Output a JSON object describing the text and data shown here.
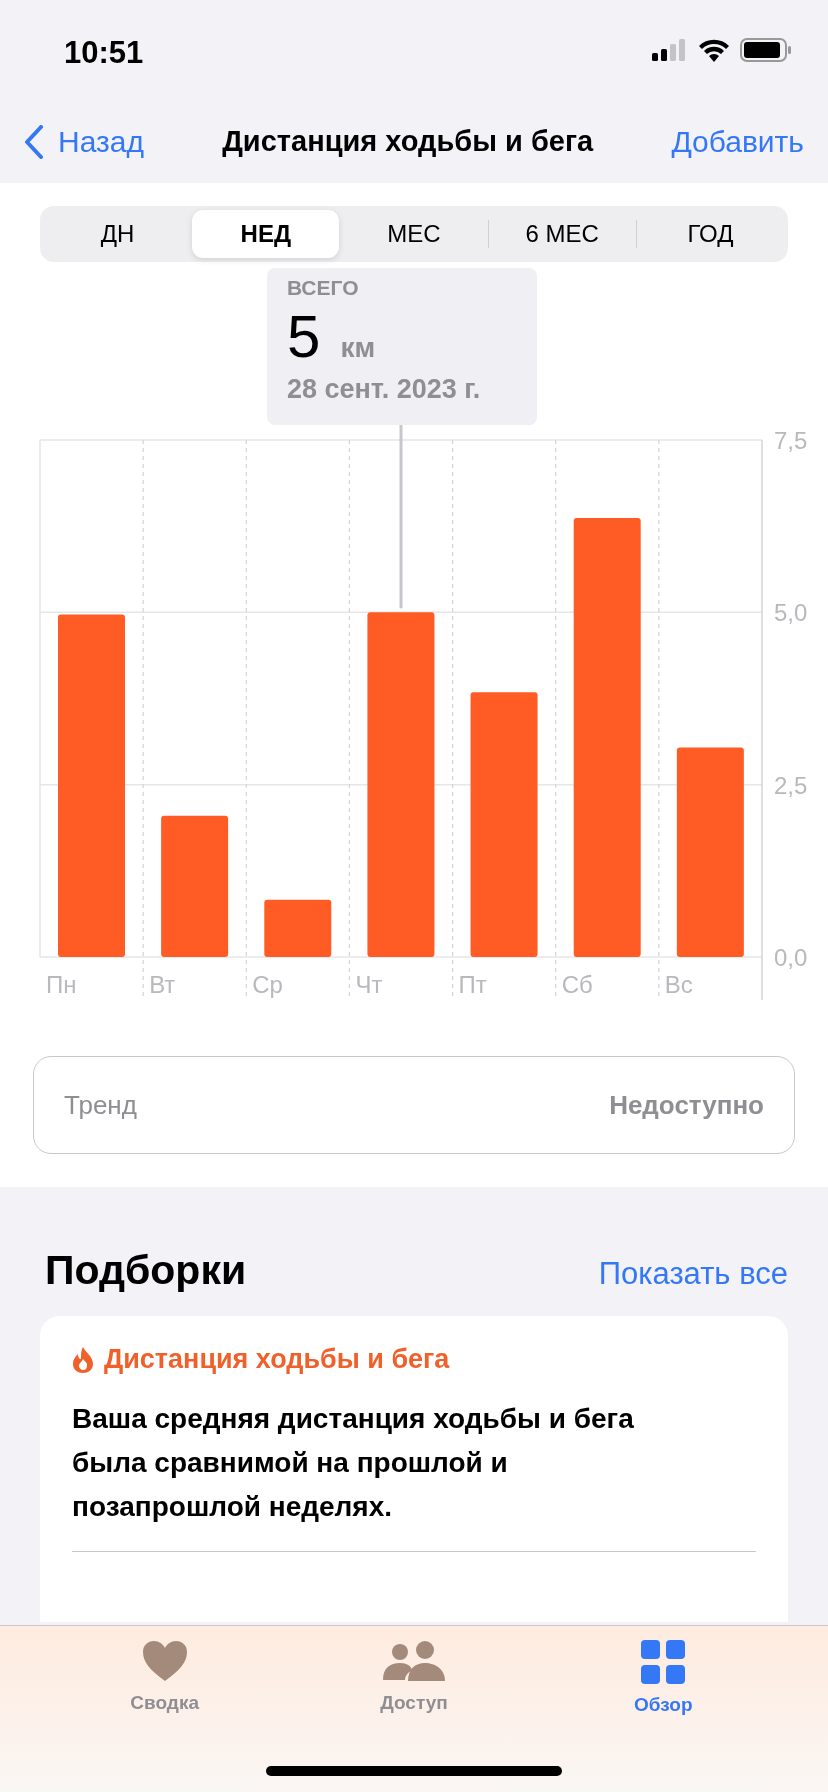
{
  "status_bar": {
    "time": "10:51"
  },
  "nav": {
    "back": "Назад",
    "title": "Дистанция ходьбы и бега",
    "action": "Добавить"
  },
  "ranges": [
    {
      "label": "ДН",
      "selected": false
    },
    {
      "label": "НЕД",
      "selected": true
    },
    {
      "label": "МЕС",
      "selected": false
    },
    {
      "label": "6 МЕС",
      "selected": false
    },
    {
      "label": "ГОД",
      "selected": false
    }
  ],
  "tooltip": {
    "heading": "ВСЕГО",
    "value": "5",
    "unit": "км",
    "date": "28 сент. 2023 г."
  },
  "chart": {
    "chart_data": {
      "type": "bar",
      "categories": [
        "Пн",
        "Вт",
        "Ср",
        "Чт",
        "Пт",
        "Сб",
        "Вс"
      ],
      "values": [
        4.97,
        2.05,
        0.83,
        5.0,
        3.84,
        6.37,
        3.04
      ],
      "ylim": [
        0,
        7.5
      ],
      "yticks": [
        {
          "value": 0,
          "label": "0,0"
        },
        {
          "value": 2.5,
          "label": "2,5"
        },
        {
          "value": 5,
          "label": "5,0"
        },
        {
          "value": 7.5,
          "label": "7,5"
        }
      ],
      "annotations": [
        {
          "x": "Чт"
        }
      ]
    }
  },
  "trend": {
    "label": "Тренд",
    "value": "Недоступно"
  },
  "highlights": {
    "title": "Подборки",
    "show_all": "Показать все",
    "card": {
      "category": "Дистанция ходьбы и бега",
      "text": "Ваша средняя дистанция ходьбы и бега была сравнимой на прошлой и позапрошлой неделях."
    }
  },
  "tab_bar": [
    {
      "label": "Сводка",
      "kind": "heart",
      "selected": false
    },
    {
      "label": "Доступ",
      "kind": "people",
      "selected": false
    },
    {
      "label": "Обзор",
      "kind": "grid",
      "selected": true
    }
  ]
}
